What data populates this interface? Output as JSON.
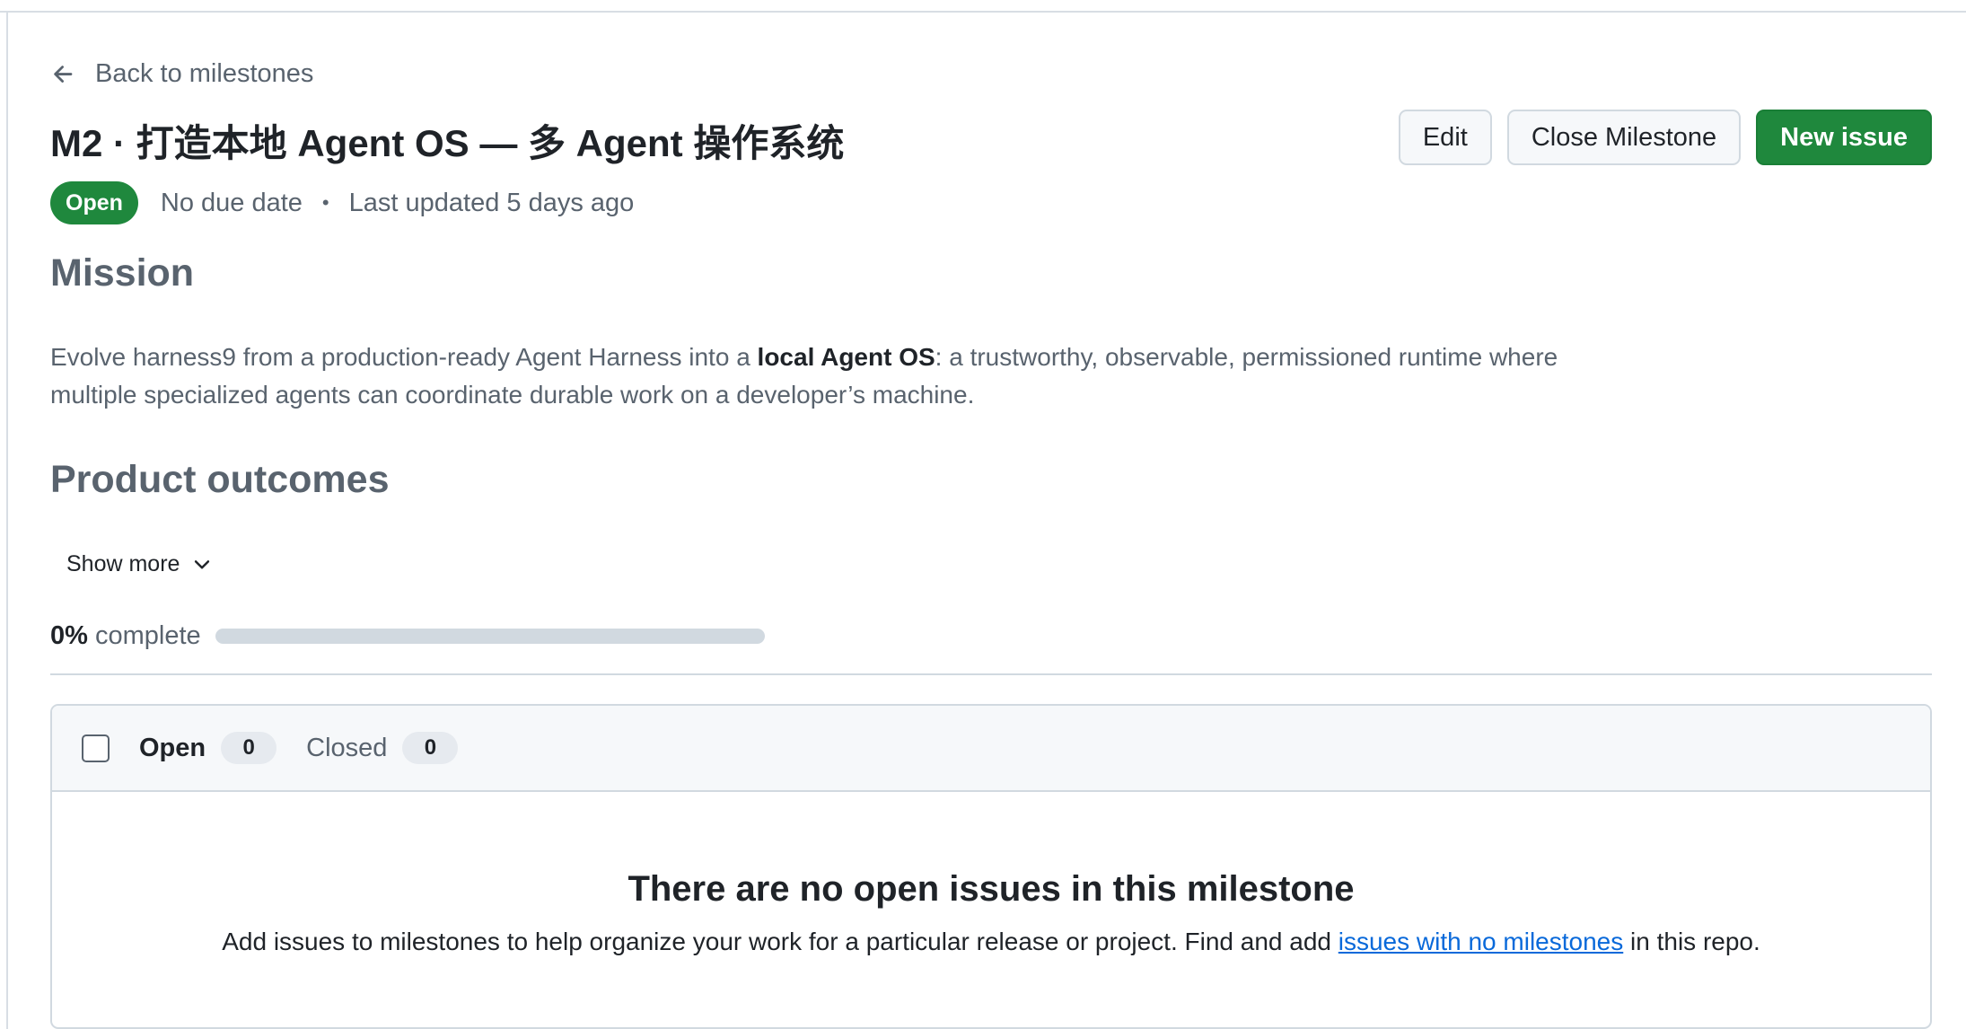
{
  "nav": {
    "back_label": "Back to milestones"
  },
  "milestone": {
    "title": "M2 · 打造本地 Agent OS — 多 Agent 操作系统",
    "status": "Open",
    "due": "No due date",
    "separator": "•",
    "updated": "Last updated 5 days ago"
  },
  "actions": {
    "edit": "Edit",
    "close": "Close Milestone",
    "new_issue": "New issue"
  },
  "description": {
    "mission_heading": "Mission",
    "mission_pre": "Evolve harness9 from a production-ready Agent Harness into a ",
    "mission_bold": "local Agent OS",
    "mission_post": ": a trustworthy, observable, permissioned runtime where multiple specialized agents can coordinate durable work on a developer’s machine.",
    "outcomes_heading": "Product outcomes",
    "show_more": "Show more"
  },
  "progress": {
    "percent_label": "0%",
    "complete_label": "complete",
    "fraction": 0
  },
  "issues": {
    "open_label": "Open",
    "open_count": "0",
    "closed_label": "Closed",
    "closed_count": "0",
    "empty_title": "There are no open issues in this milestone",
    "empty_pre": "Add issues to milestones to help organize your work for a particular release or project. Find and add ",
    "empty_link": "issues with no milestones",
    "empty_post": " in this repo."
  },
  "colors": {
    "primary_green": "#1f883d",
    "link_blue": "#0969da",
    "muted_text": "#59636e"
  },
  "icons": [
    "arrow-left-icon",
    "chevron-down-icon"
  ]
}
